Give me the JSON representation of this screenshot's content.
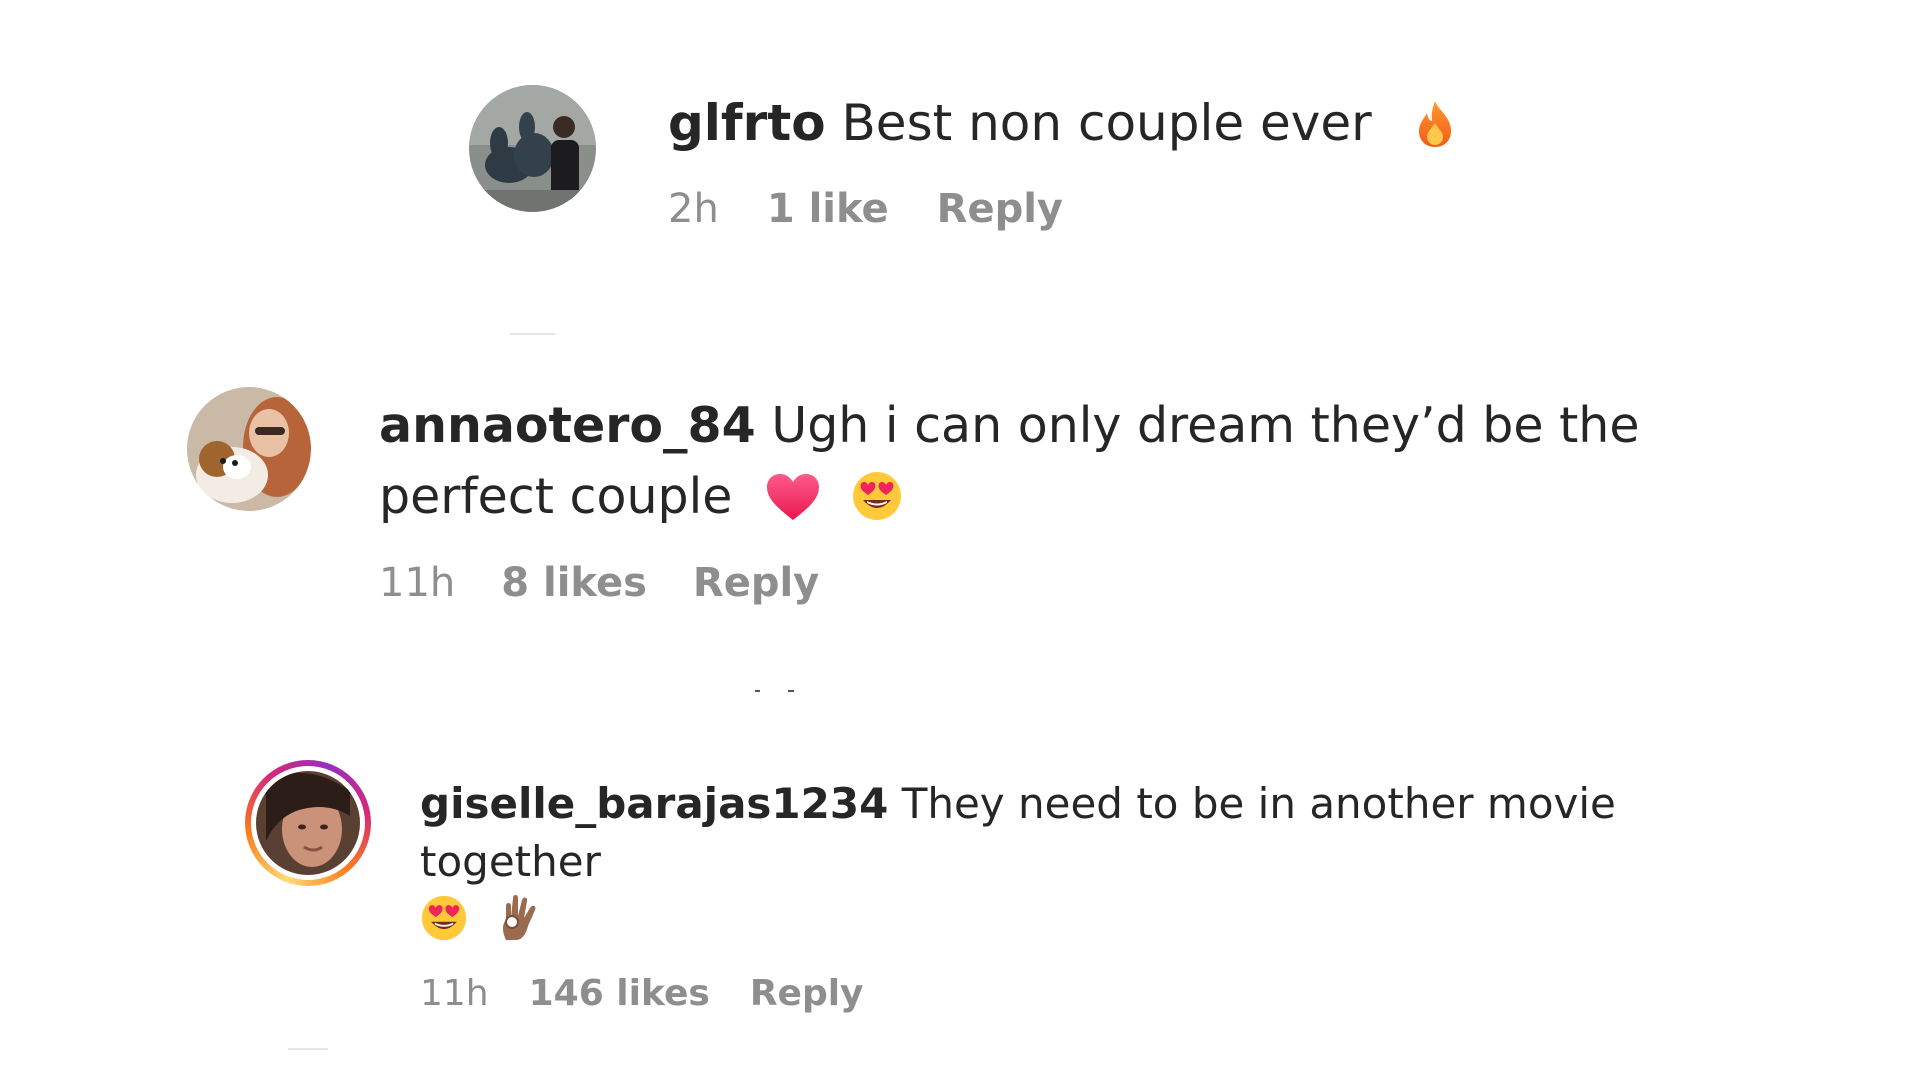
{
  "comments": [
    {
      "username": "glfrto",
      "text": "Best non couple ever",
      "emojis": [
        "fire-emoji"
      ],
      "time": "2h",
      "likes": "1 like",
      "reply_label": "Reply"
    },
    {
      "username": "annaotero_84",
      "text": "Ugh i can only dream they’d be the perfect couple",
      "emojis": [
        "red-heart-emoji",
        "heart-eyes-emoji"
      ],
      "time": "11h",
      "likes": "8 likes",
      "reply_label": "Reply"
    },
    {
      "username": "giselle_barajas1234",
      "text": "They need to be in another movie together",
      "emojis": [
        "heart-eyes-emoji",
        "ok-hand-emoji"
      ],
      "time": "11h",
      "likes": "146 likes",
      "reply_label": "Reply"
    }
  ],
  "colors": {
    "text": "#262626",
    "meta": "#8e8e8e",
    "story_ring": [
      "#feda75",
      "#fa7e1e",
      "#d62976",
      "#962fbf"
    ]
  }
}
